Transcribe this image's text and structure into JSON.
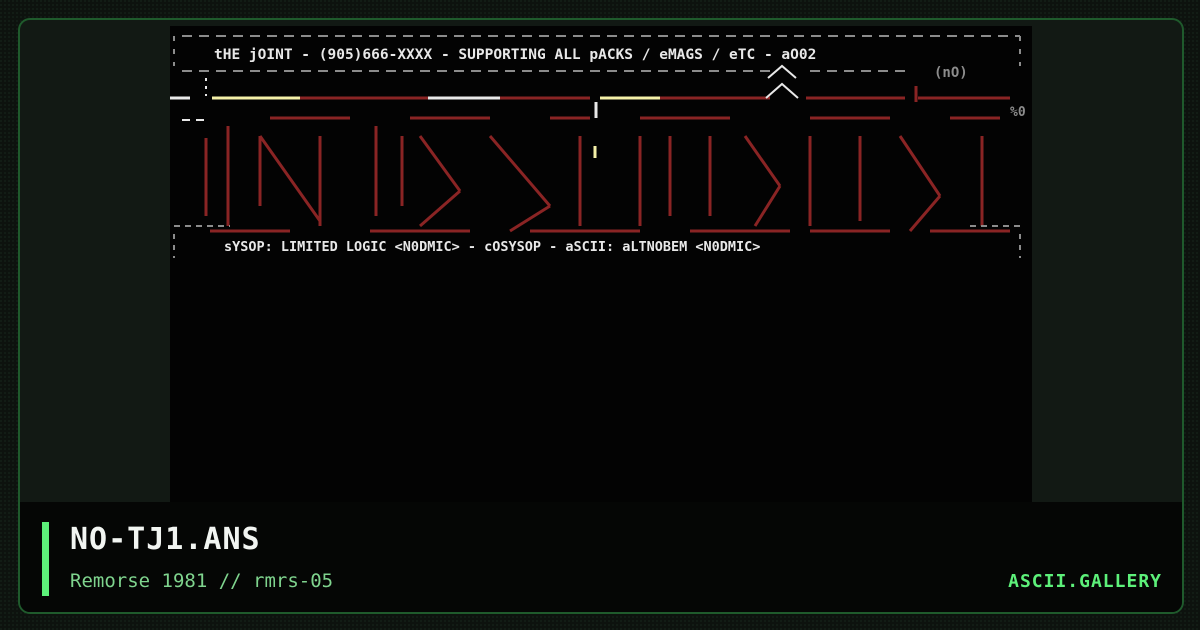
{
  "artwork": {
    "header_line": "tHE jOINT - (905)666-XXXX - SUPPORTING ALL pACKS / eMAGS / eTC -   aO02",
    "tag_line": "(nO)",
    "footer_line": "sYSOP: LIMITED LOGIC <N0DMIC> - cOSYSOP - aSCII: aLTNOBEM <N0DMIC>",
    "corner_mark": "%0"
  },
  "file": {
    "title": "NO-TJ1.ANS",
    "subtitle": "Remorse 1981 // rmrs-05"
  },
  "brand": {
    "label": "ASCII.GALLERY"
  },
  "colors": {
    "accent": "#5df07a",
    "ansi_red": "#8a2424",
    "ansi_white": "#e8e8e8",
    "ansi_grey": "#8c8c8c",
    "ansi_yellow": "#f4f0a8"
  }
}
